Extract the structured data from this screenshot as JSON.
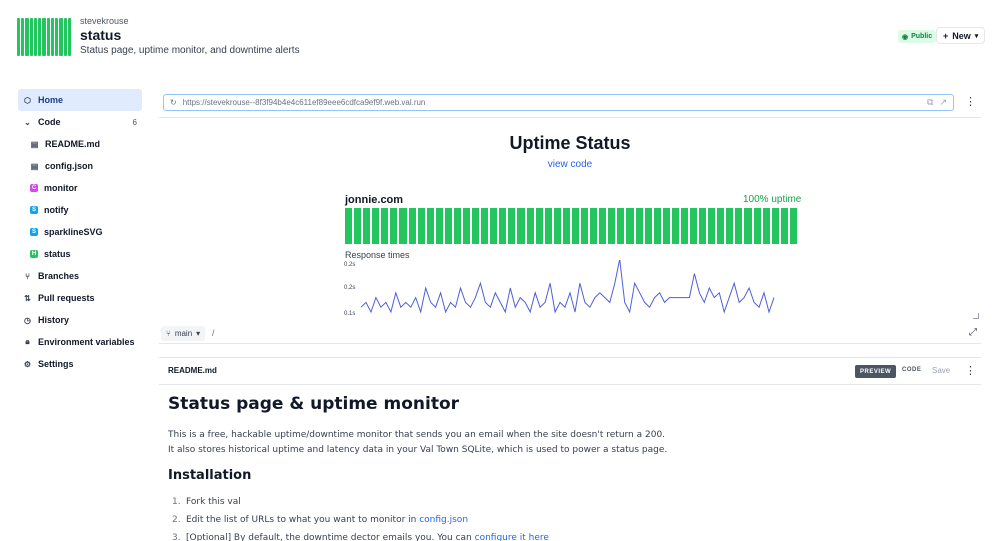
{
  "header": {
    "owner": "stevekrouse",
    "name": "status",
    "description": "Status page, uptime monitor, and downtime alerts",
    "visibility_badge": "Public",
    "new_button": "New",
    "brand_color": "#22c55e"
  },
  "sidebar": {
    "items": [
      {
        "label": "Home",
        "icon": "home-icon",
        "active": true
      },
      {
        "label": "Code",
        "icon": "chevron-down-icon",
        "count": "6"
      },
      {
        "label": "README.md",
        "icon": "file-icon"
      },
      {
        "label": "config.json",
        "icon": "file-icon"
      },
      {
        "label": "monitor",
        "tag": "C",
        "tag_color": "#d946ef"
      },
      {
        "label": "notify",
        "tag": "S",
        "tag_color": "#0ea5e9"
      },
      {
        "label": "sparklineSVG",
        "tag": "S",
        "tag_color": "#0ea5e9"
      },
      {
        "label": "status",
        "tag": "H",
        "tag_color": "#22c55e"
      },
      {
        "label": "Branches",
        "icon": "branch-icon"
      },
      {
        "label": "Pull requests",
        "icon": "pull-request-icon"
      },
      {
        "label": "History",
        "icon": "history-icon"
      },
      {
        "label": "Environment variables",
        "icon": "lock-icon"
      },
      {
        "label": "Settings",
        "icon": "gear-icon"
      }
    ]
  },
  "preview": {
    "url": "https://stevekrouse--8f3f94b4e4c611ef89eee6cdfca9ef9f.web.val.run",
    "page_title": "Uptime Status",
    "view_code": "view code",
    "site": "jonnie.com",
    "uptime": "100% uptime",
    "uptime_bar_count": 50,
    "response_label": "Response times",
    "branch": "main",
    "path_sep": "/"
  },
  "chart_data": {
    "type": "line",
    "title": "",
    "xlabel": "",
    "ylabel": "",
    "y_ticks": [
      "0.2s",
      "0.2s",
      "0.1s"
    ],
    "values": [
      0.11,
      0.12,
      0.1,
      0.13,
      0.11,
      0.12,
      0.1,
      0.14,
      0.11,
      0.12,
      0.11,
      0.13,
      0.1,
      0.15,
      0.12,
      0.11,
      0.14,
      0.1,
      0.12,
      0.11,
      0.15,
      0.12,
      0.11,
      0.13,
      0.16,
      0.12,
      0.11,
      0.14,
      0.12,
      0.1,
      0.15,
      0.11,
      0.13,
      0.12,
      0.1,
      0.14,
      0.11,
      0.12,
      0.16,
      0.1,
      0.12,
      0.11,
      0.14,
      0.1,
      0.16,
      0.12,
      0.11,
      0.13,
      0.14,
      0.13,
      0.12,
      0.16,
      0.21,
      0.12,
      0.1,
      0.16,
      0.14,
      0.12,
      0.11,
      0.13,
      0.14,
      0.12,
      0.13,
      0.13,
      0.13,
      0.13,
      0.13,
      0.18,
      0.14,
      0.12,
      0.15,
      0.13,
      0.14,
      0.1,
      0.13,
      0.16,
      0.12,
      0.13,
      0.15,
      0.12,
      0.11,
      0.14,
      0.1,
      0.13
    ],
    "ylim": [
      0.1,
      0.2
    ],
    "line_color": "#4f5fd6"
  },
  "readme": {
    "filename": "README.md",
    "tab_preview": "PREVIEW",
    "tab_code": "CODE",
    "save": "Save",
    "h1": "Status page & uptime monitor",
    "para": "This is a free, hackable uptime/downtime monitor that sends you an email when the site doesn't return a 200. It also stores historical uptime and latency data in your Val Town SQLite, which is used to power a status page.",
    "h2": "Installation",
    "steps": [
      {
        "num": "1.",
        "text": "Fork this val",
        "link": ""
      },
      {
        "num": "2.",
        "text": "Edit the list of URLs to what you want to monitor in ",
        "link": "config.json"
      },
      {
        "num": "3.",
        "text": "[Optional] By default, the downtime dector emails you. You can ",
        "link": "configure it here"
      }
    ]
  }
}
